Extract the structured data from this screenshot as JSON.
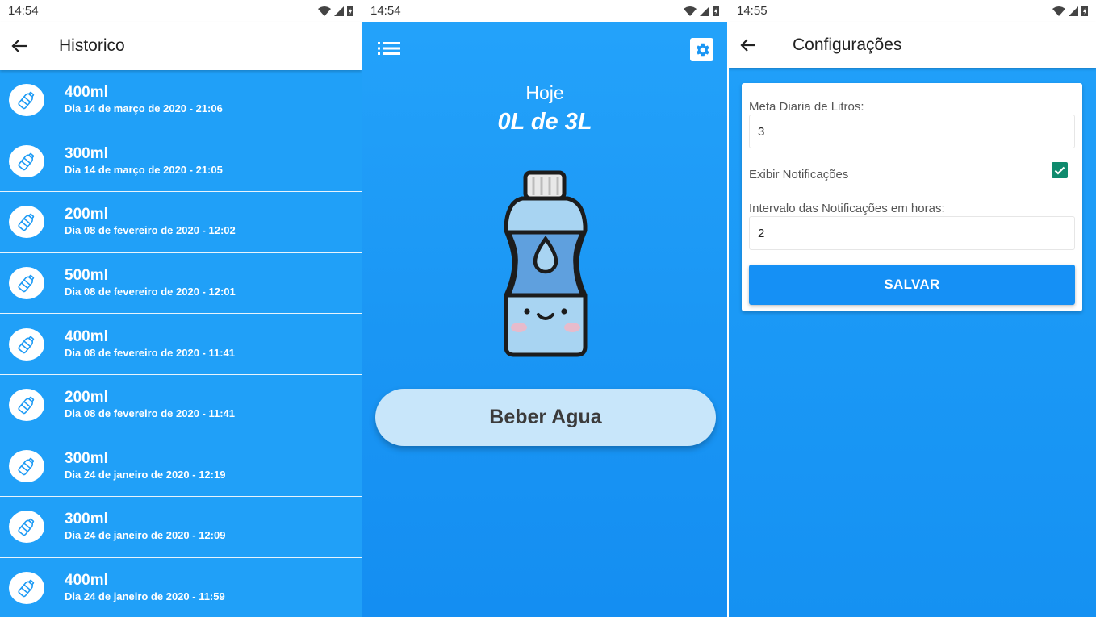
{
  "history_screen": {
    "status_time": "14:54",
    "title": "Historico",
    "entries": [
      {
        "amount": "400ml",
        "date": "Dia 14 de março de 2020 - 21:06"
      },
      {
        "amount": "300ml",
        "date": "Dia 14 de março de 2020 - 21:05"
      },
      {
        "amount": "200ml",
        "date": "Dia 08 de fevereiro de 2020 - 12:02"
      },
      {
        "amount": "500ml",
        "date": "Dia 08 de fevereiro de 2020 - 12:01"
      },
      {
        "amount": "400ml",
        "date": "Dia 08 de fevereiro de 2020 - 11:41"
      },
      {
        "amount": "200ml",
        "date": "Dia 08 de fevereiro de 2020 - 11:41"
      },
      {
        "amount": "300ml",
        "date": "Dia 24 de janeiro de 2020 - 12:19"
      },
      {
        "amount": "300ml",
        "date": "Dia 24 de janeiro de 2020 - 12:09"
      },
      {
        "amount": "400ml",
        "date": "Dia 24 de janeiro de 2020 - 11:59"
      }
    ]
  },
  "home_screen": {
    "status_time": "14:54",
    "today_label": "Hoje",
    "today_value": "0L de 3L",
    "drink_button": "Beber Agua"
  },
  "settings_screen": {
    "status_time": "14:55",
    "title": "Configurações",
    "goal_label": "Meta Diaria de Litros:",
    "goal_value": "3",
    "notifications_label": "Exibir Notificações",
    "notifications_checked": true,
    "interval_label": "Intervalo das Notificações em horas:",
    "interval_value": "2",
    "save_button": "SALVAR"
  },
  "colors": {
    "primary_blue": "#20a0f8",
    "button_blue": "#1590f5",
    "drink_button_bg": "#c8e6fa",
    "checkbox_green": "#0f8a6d"
  },
  "icons": [
    "arrow-back-icon",
    "bottle-icon",
    "menu-list-icon",
    "gear-icon",
    "check-icon",
    "wifi-icon",
    "signal-icon",
    "battery-icon"
  ]
}
